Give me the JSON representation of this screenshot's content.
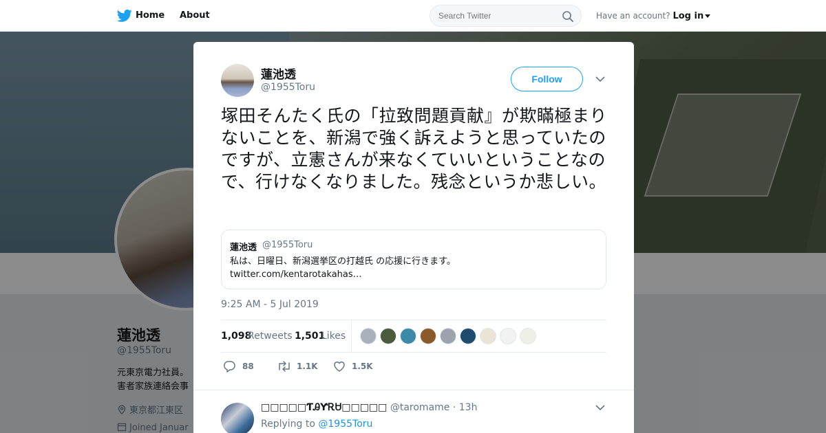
{
  "nav": {
    "home_label": "Home",
    "about_label": "About",
    "search_placeholder": "Search Twitter",
    "account_prompt": "Have an account?",
    "login_label": "Log in",
    "brand_color": "#1da1f2"
  },
  "profile": {
    "name": "蓮池透",
    "handle": "@1955Toru",
    "bio_lines": [
      "元東京電力社員。",
      "害者家族連絡会事"
    ],
    "location": "東京都江東区",
    "joined": "Joined Januar"
  },
  "tweet": {
    "author_name": "蓮池透",
    "author_handle": "@1955Toru",
    "follow_label": "Follow",
    "text": "塚田そんたく氏の「拉致問題貢献』が欺瞞極まりないことを、新潟で強く訴えようと思っていたのですが、立憲さんが来なくていいということなので、行けなくなりました。残念というか悲しい。",
    "quoted": {
      "name": "蓮池透",
      "handle": "@1955Toru",
      "text_line1": "私は、日曜日、新潟選挙区の打越氏 の応援に行きます。",
      "text_line2": "twitter.com/kentarotakahas…"
    },
    "timestamp": "9:25 AM - 5 Jul 2019",
    "retweets_count": "1,098",
    "retweets_label": "Retweets",
    "likes_count": "1,501",
    "likes_label": "Likes",
    "reply_count": "88",
    "retweet_action_count": "1.1K",
    "like_action_count": "1.5K",
    "liker_avatar_colors": [
      "#a9b2bc",
      "#4a5a3a",
      "#3c8aa8",
      "#8a5a2a",
      "#9ca4ae",
      "#1f4c6e",
      "#e9e4d6",
      "#f2f2f2",
      "#eef0e6"
    ]
  },
  "reply": {
    "author_name": "□□□□□ƬᎯƳᎡᏌ□□□□□",
    "author_handle": "@taromame",
    "age": "13h",
    "replying_label": "Replying to",
    "replying_to": "@1955Toru"
  }
}
